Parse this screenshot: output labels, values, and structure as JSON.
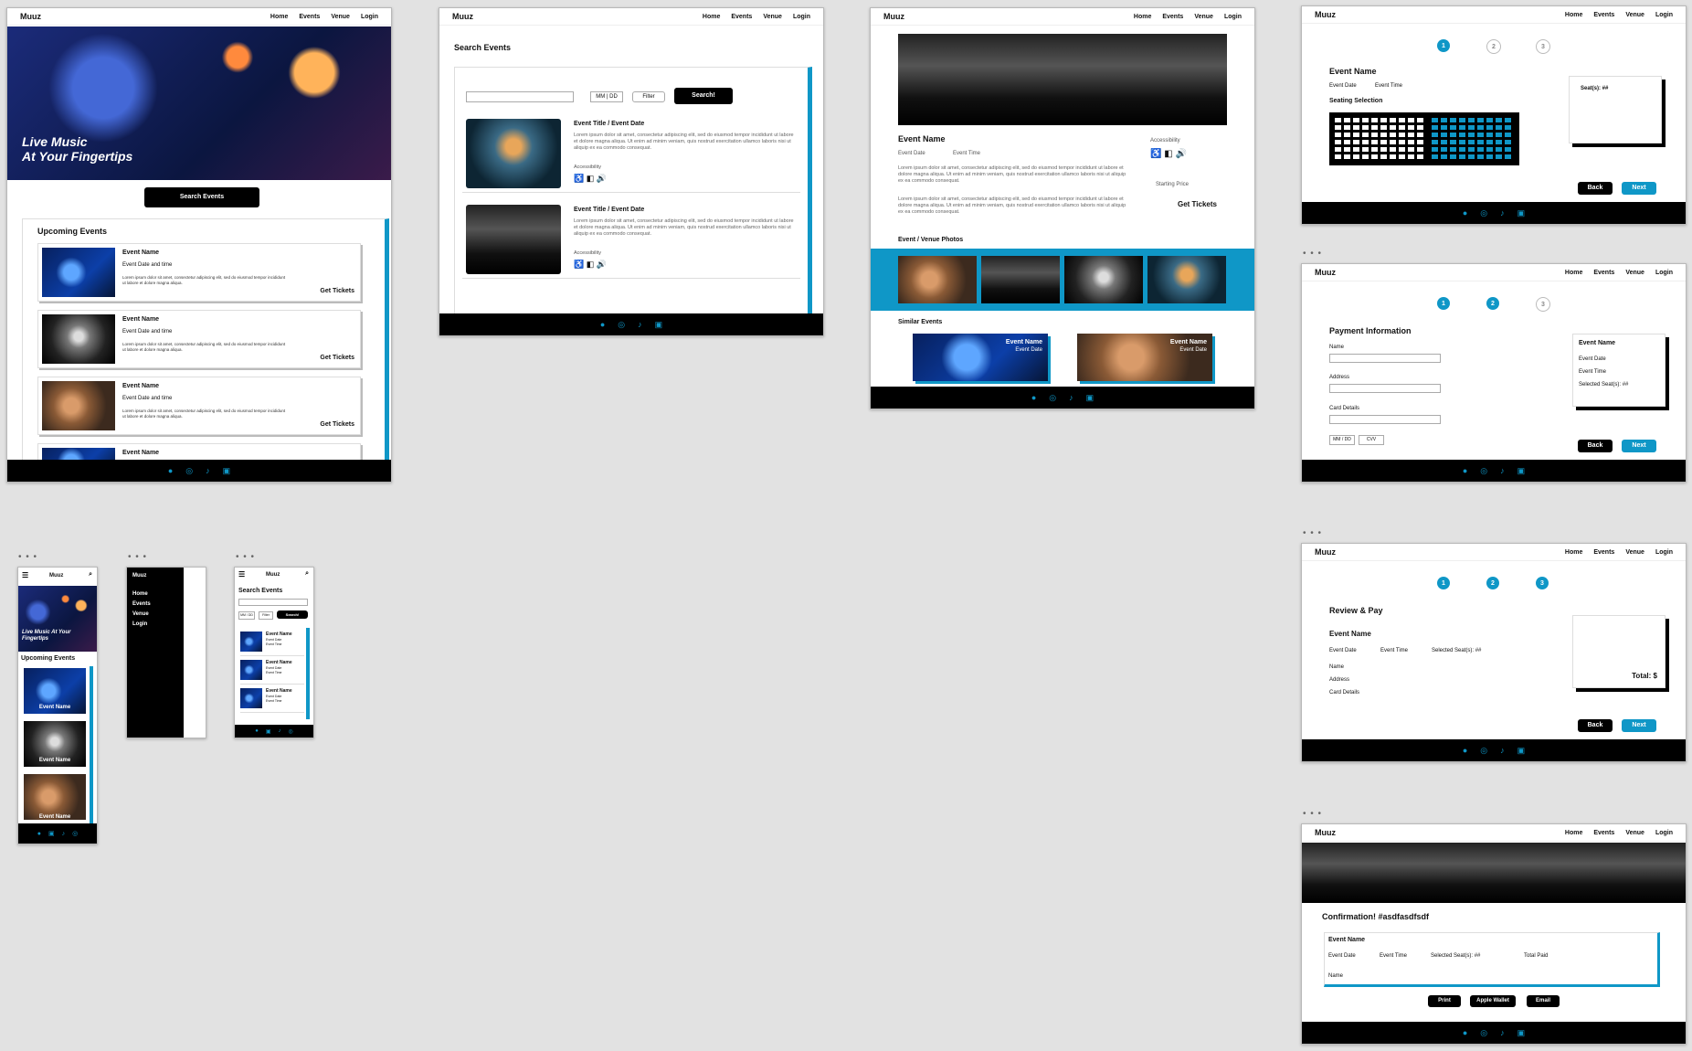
{
  "brand": "Muuz",
  "nav": [
    "Home",
    "Events",
    "Venue",
    "Login"
  ],
  "desktop_home": {
    "hero_line1": "Live Music",
    "hero_line2": "At Your Fingertips",
    "search_button": "Search Events",
    "upcoming_title": "Upcoming Events",
    "events": [
      {
        "name": "Event Name",
        "date": "Event Date and time",
        "desc": "Lorem ipsum dolor sit amet, consectetur adipiscing elit, sed do eiusmod tempor incididunt ut labore et dolore magna aliqua.",
        "cta": "Get Tickets"
      },
      {
        "name": "Event Name",
        "date": "Event Date and time",
        "desc": "Lorem ipsum dolor sit amet, consectetur adipiscing elit, sed do eiusmod tempor incididunt ut labore et dolore magna aliqua.",
        "cta": "Get Tickets"
      },
      {
        "name": "Event Name",
        "date": "Event Date and time",
        "desc": "Lorem ipsum dolor sit amet, consectetur adipiscing elit, sed do eiusmod tempor incididunt ut labore et dolore magna aliqua.",
        "cta": "Get Tickets"
      },
      {
        "name": "Event Name"
      }
    ]
  },
  "search_page": {
    "title": "Search Events",
    "date_placeholder": "MM | DD",
    "filter": "Filter",
    "search_button": "Search!",
    "results": [
      {
        "title": "Event Title / Event Date",
        "desc": "Lorem ipsum dolor sit amet, consectetur adipiscing elit, sed do eiusmod tempor incididunt ut labore et dolore magna aliqua. Ut enim ad minim veniam, quis nostrud exercitation ullamco laboris nisi ut aliquip ex ea commodo consequat.",
        "access": "Accessibility"
      },
      {
        "title": "Event Title / Event Date",
        "desc": "Lorem ipsum dolor sit amet, consectetur adipiscing elit, sed do eiusmod tempor incididunt ut labore et dolore magna aliqua. Ut enim ad minim veniam, quis nostrud exercitation ullamco laboris nisi ut aliquip ex ea commodo consequat.",
        "access": "Accessibility"
      }
    ]
  },
  "event_page": {
    "name": "Event Name",
    "date": "Event Date",
    "time": "Event Time",
    "desc": "Lorem ipsum dolor sit amet, consectetur adipiscing elit, sed do eiusmod tempor incididunt ut labore et dolore magna aliqua. Ut enim ad minim veniam, quis nostrud exercitation ullamco laboris nisi ut aliquip ex ea commodo consequat.",
    "access": "Accessibility",
    "starting_price": "Starting Price",
    "cta": "Get Tickets",
    "photos_title": "Event / Venue Photos",
    "similar_title": "Similar Events",
    "similar": [
      {
        "name": "Event Name",
        "date": "Event Date"
      },
      {
        "name": "Event Name",
        "date": "Event Date"
      }
    ]
  },
  "seat_page": {
    "name": "Event Name",
    "date": "Event Date",
    "time": "Event Time",
    "seating": "Seating Selection",
    "seats": "Seat(s): ##",
    "back": "Back",
    "next": "Next",
    "steps": [
      "1",
      "2",
      "3"
    ]
  },
  "payment_page": {
    "title": "Payment Information",
    "name": "Name",
    "address": "Address",
    "card": "Card Details",
    "mmdd": "MM / DD",
    "cvv": "CVV",
    "summary_name": "Event Name",
    "summary_date": "Event Date",
    "summary_time": "Event Time",
    "summary_seats": "Selected Seat(s): ##",
    "back": "Back",
    "next": "Next"
  },
  "review_page": {
    "title": "Review & Pay",
    "name": "Event Name",
    "date": "Event Date",
    "time": "Event Time",
    "seats": "Selected Seat(s): ##",
    "f_name": "Name",
    "f_address": "Address",
    "f_card": "Card Details",
    "total": "Total: $",
    "back": "Back",
    "next": "Next"
  },
  "confirm_page": {
    "title": "Confirmation! #asdfasdfsdf",
    "name": "Event Name",
    "date": "Event Date",
    "time": "Event Time",
    "seats": "Selected Seat(s): ##",
    "paid": "Total Paid",
    "f_name": "Name",
    "print": "Print",
    "wallet": "Apple Wallet",
    "email": "Email"
  },
  "mobile_home": {
    "brand": "Muuz",
    "hero": "Live Music At Your Fingertips",
    "upcoming": "Upcoming Events",
    "cards": [
      "Event Name",
      "Event Name",
      "Event Name"
    ]
  },
  "mobile_menu": {
    "brand": "Muuz",
    "items": [
      "Home",
      "Events",
      "Venue",
      "Login"
    ]
  },
  "mobile_search": {
    "brand": "Muuz",
    "title": "Search Events",
    "date": "MM / DD",
    "filter": "Filter",
    "search": "Search!",
    "results": [
      {
        "name": "Event Name",
        "date": "Event Date",
        "time": "Event Time"
      },
      {
        "name": "Event Name",
        "date": "Event Date",
        "time": "Event Time"
      },
      {
        "name": "Event Name",
        "date": "Event Date",
        "time": "Event Time"
      }
    ]
  },
  "dots": "• • •",
  "colors": {
    "accent": "#0f97c7",
    "dark": "#000000"
  }
}
